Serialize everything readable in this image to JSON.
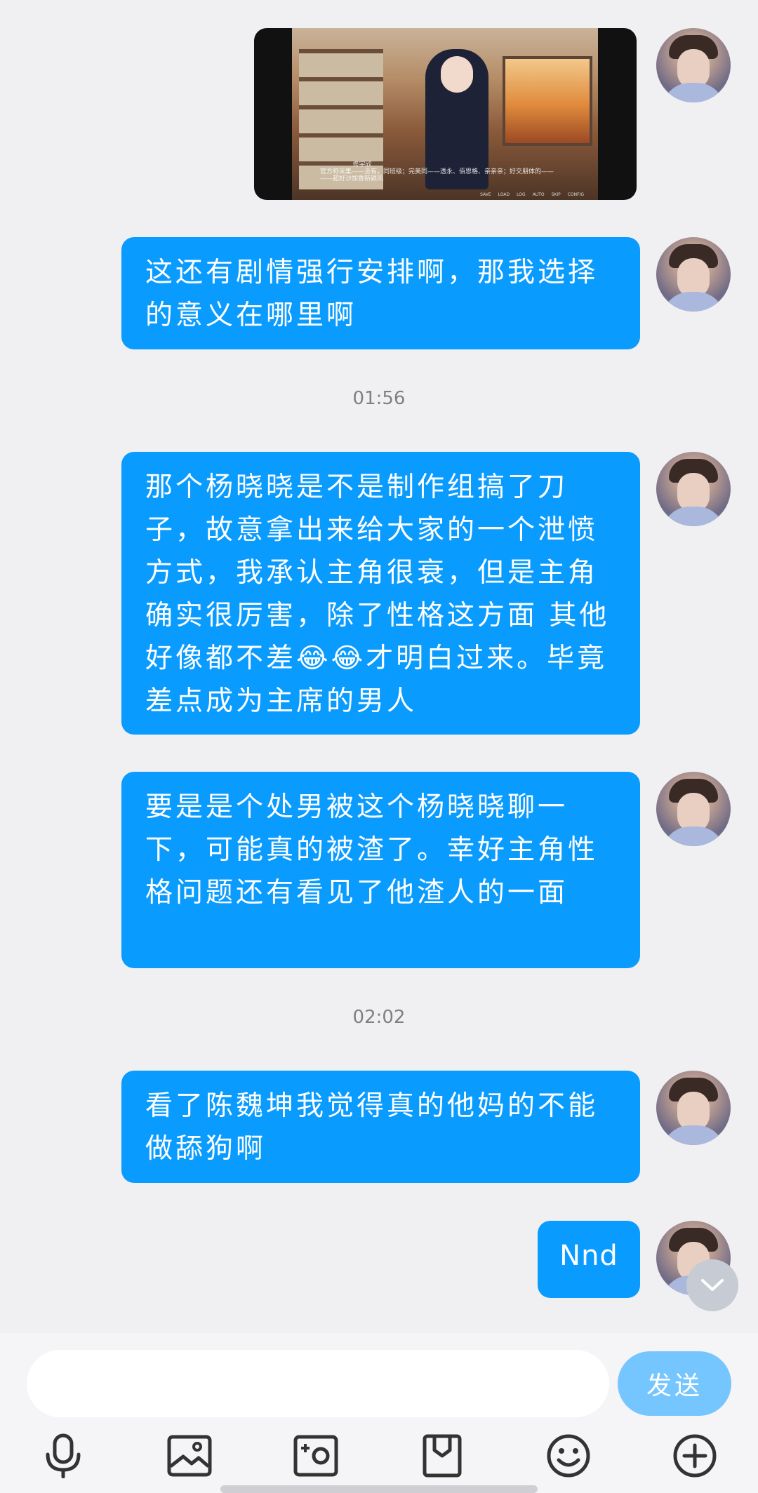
{
  "messages": [
    {
      "type": "image",
      "caption_lines": [
        "佟宇欣",
        "官方称采集——没有，同班级；完美同——透永、佰恩格、亲亲亲；好交朋体的——",
        "——超好沙加香新颍风"
      ],
      "menu": [
        "SAVE",
        "LOAD",
        "LOG",
        "AUTO",
        "SKIP",
        "CONFIG"
      ]
    },
    {
      "type": "text",
      "text": "这还有剧情强行安排啊，那我选择的意义在哪里啊"
    },
    {
      "type": "time",
      "text": "01:56"
    },
    {
      "type": "text",
      "text": "那个杨晓晓是不是制作组搞了刀子，故意拿出来给大家的一个泄愤方式，我承认主角很衰，但是主角确实很厉害，除了性格这方面 其他好像都不差😂😂才明白过来。毕竟差点成为主席的男人"
    },
    {
      "type": "text",
      "text": "要是是个处男被这个杨晓晓聊一下，可能真的被渣了。幸好主角性格问题还有看见了他渣人的一面"
    },
    {
      "type": "time",
      "text": "02:02"
    },
    {
      "type": "text",
      "text": "看了陈魏坤我觉得真的他妈的不能做舔狗啊"
    },
    {
      "type": "text",
      "text": "Nnd"
    }
  ],
  "composer": {
    "input_placeholder": "",
    "send_label": "发送"
  },
  "toolbar": [
    "microphone-icon",
    "image-icon",
    "camera-icon",
    "file-icon",
    "emoji-icon",
    "plus-icon"
  ],
  "colors": {
    "bubble": "#0a9bff",
    "send": "#75c6ff",
    "background": "#f0f0f2"
  }
}
